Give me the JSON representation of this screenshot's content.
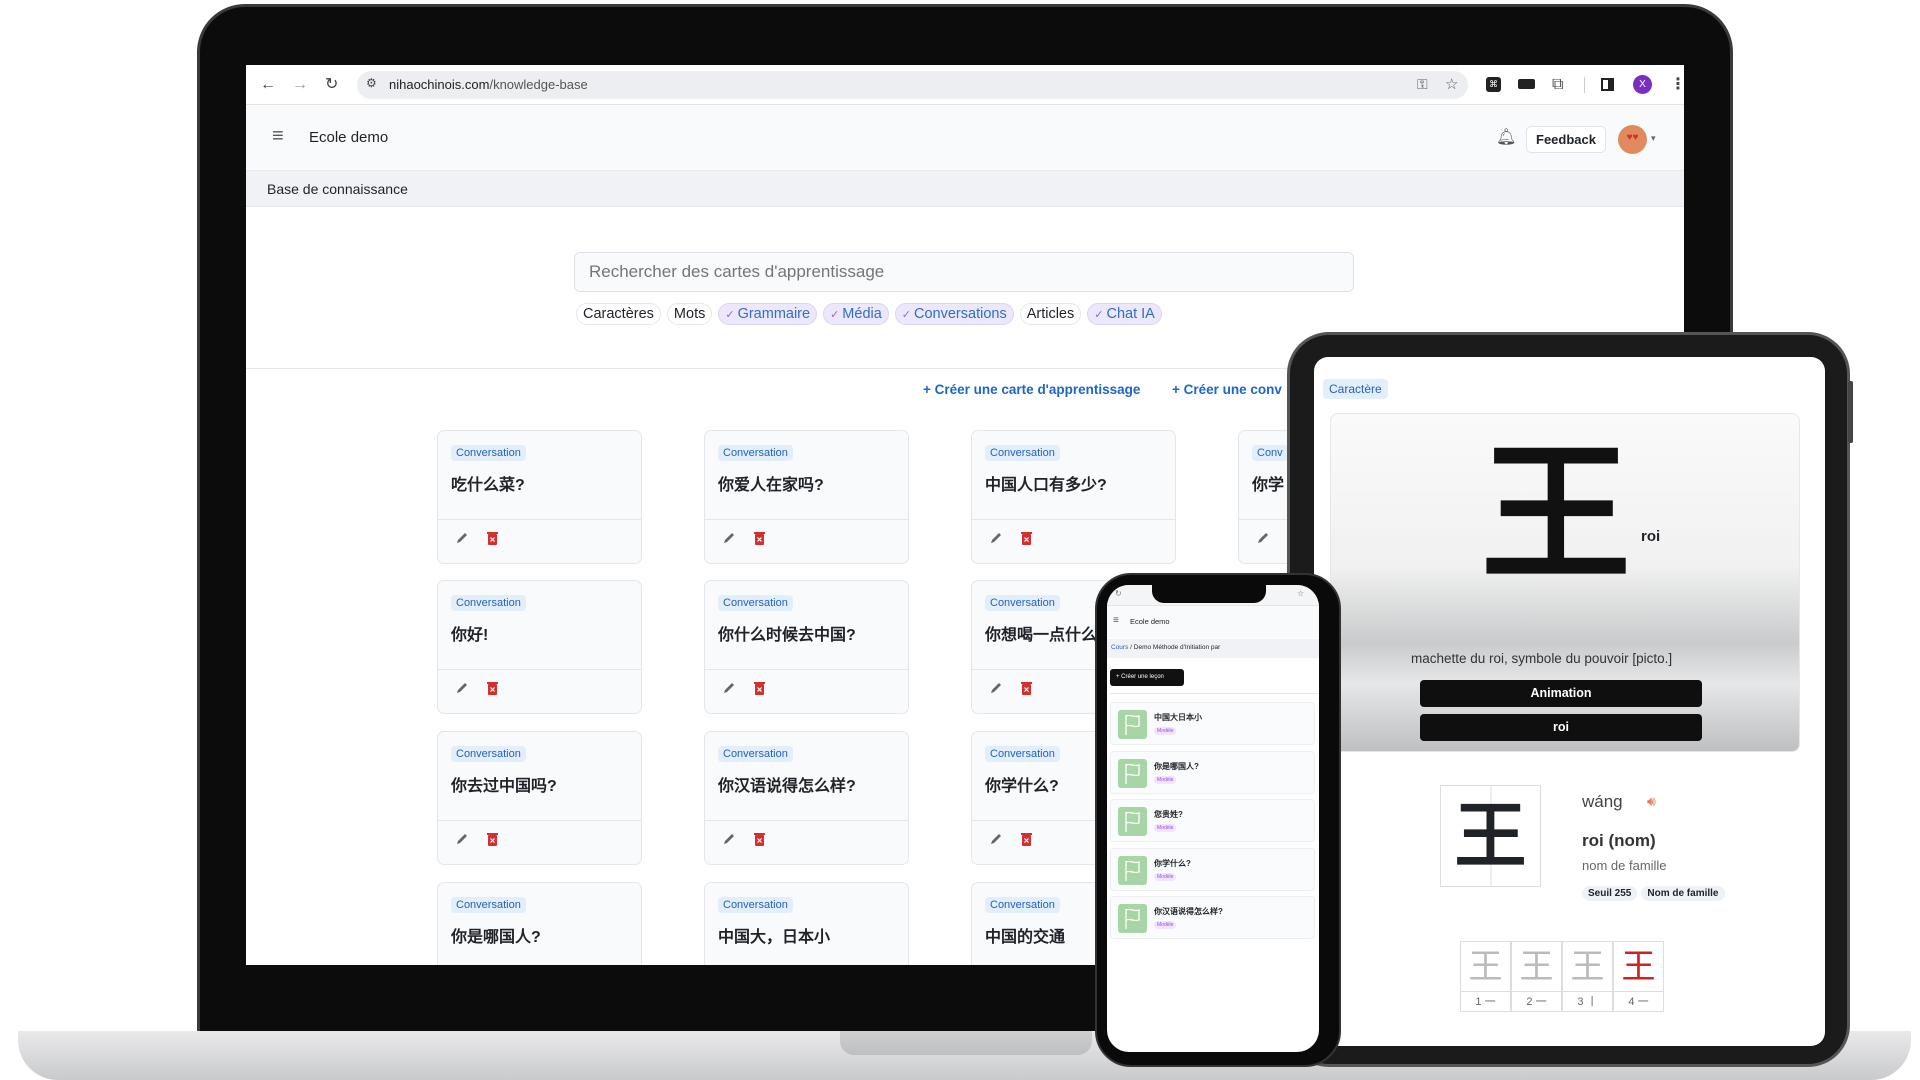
{
  "browser": {
    "url_domain": "nihaochinois.com",
    "url_path": "/knowledge-base",
    "profile_initial": "X"
  },
  "app": {
    "school_name": "Ecole demo",
    "feedback_label": "Feedback",
    "breadcrumb": "Base de connaissance"
  },
  "search": {
    "placeholder": "Rechercher des cartes d'apprentissage"
  },
  "filters": [
    {
      "label": "Caractères",
      "active": false
    },
    {
      "label": "Mots",
      "active": false
    },
    {
      "label": "Grammaire",
      "active": true
    },
    {
      "label": "Média",
      "active": true
    },
    {
      "label": "Conversations",
      "active": true
    },
    {
      "label": "Articles",
      "active": false
    },
    {
      "label": "Chat IA",
      "active": true
    }
  ],
  "actions": {
    "create_card": "Créer une carte d'apprentissage",
    "create_other": "Créer une conv"
  },
  "cards": [
    {
      "type": "Conversation",
      "title": "吃什么菜?"
    },
    {
      "type": "Conversation",
      "title": "你爱人在家吗?"
    },
    {
      "type": "Conversation",
      "title": "中国人口有多少?"
    },
    {
      "type": "Conv",
      "title": "你学"
    },
    {
      "type": "Conversation",
      "title": "你好!"
    },
    {
      "type": "Conversation",
      "title": "你什么时候去中国?"
    },
    {
      "type": "Conversation",
      "title": "你想喝一点什么"
    },
    {
      "type": "Conversation",
      "title": "你去过中国吗?"
    },
    {
      "type": "Conversation",
      "title": "你汉语说得怎么样?"
    },
    {
      "type": "Conversation",
      "title": "你学什么?"
    },
    {
      "type": "Conversation",
      "title": "你是哪国人?"
    },
    {
      "type": "Conversation",
      "title": "中国大，日本小"
    },
    {
      "type": "Conversation",
      "title": "中国的交通"
    }
  ],
  "tablet": {
    "badge": "Caractère",
    "character": "王",
    "meaning_overlay": "roi",
    "description": "machette du roi, symbole du pouvoir [picto.]",
    "animation_button": "Animation",
    "meaning_button": "roi",
    "pinyin": "wáng",
    "definition": "roi (nom)",
    "note": "nom de famille",
    "tags": [
      "Seuil 255",
      "Nom de famille"
    ],
    "strokes": [
      {
        "n": "1",
        "s": "一"
      },
      {
        "n": "2",
        "s": "一"
      },
      {
        "n": "3",
        "s": "丨"
      },
      {
        "n": "4",
        "s": "一"
      }
    ]
  },
  "phone": {
    "school_name": "Ecole demo",
    "breadcrumb_link": "Cours",
    "breadcrumb_current": "Demo Méthode d'Initiation par",
    "create_button": "Créer une leçon",
    "lessons": [
      {
        "title": "中国大日本小",
        "badge": "Modèle"
      },
      {
        "title": "你是哪国人?",
        "badge": "Modèle"
      },
      {
        "title": "您贵姓?",
        "badge": "Modèle"
      },
      {
        "title": "你学什么?",
        "badge": "Modèle"
      },
      {
        "title": "你汉语说得怎么样?",
        "badge": "Modèle"
      }
    ]
  },
  "colors": {
    "accent": "#1d66c9",
    "danger": "#d32f2f",
    "chip_active_bg": "#ede7fb",
    "lesson_icon": "#a8d5a6"
  }
}
